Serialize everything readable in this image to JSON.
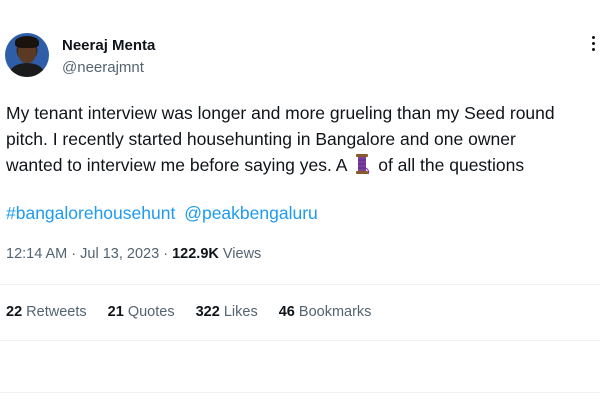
{
  "author": {
    "name": "Neeraj Menta",
    "handle": "@neerajmnt"
  },
  "tweet": {
    "lines": [
      "My tenant interview was longer and more grueling than my Seed round",
      "pitch. I recently started househunting in Bangalore and one owner"
    ],
    "line3_before_emoji": "wanted to interview me before saying yes. A",
    "emoji": "spool-of-thread-icon",
    "line3_after_emoji": "of all the questions",
    "hashtag": "#bangalorehousehunt",
    "mention": "@peakbengaluru"
  },
  "meta": {
    "time": "12:14 AM",
    "separator1": "·",
    "date": "Jul 13, 2023",
    "separator2": "·",
    "views_count": "122.9K",
    "views_label": "Views"
  },
  "stats": [
    {
      "count": "22",
      "label": "Retweets"
    },
    {
      "count": "21",
      "label": "Quotes"
    },
    {
      "count": "322",
      "label": "Likes"
    },
    {
      "count": "46",
      "label": "Bookmarks"
    }
  ],
  "colors": {
    "link": "#1d9bf0",
    "secondary_text": "#536471",
    "primary_text": "#0f1419",
    "divider": "#eff3f4"
  }
}
